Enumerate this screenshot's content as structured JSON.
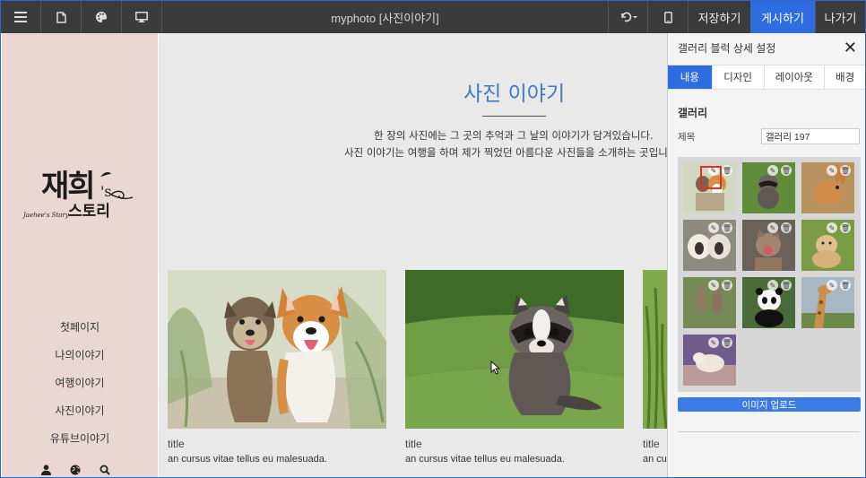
{
  "topbar": {
    "title": "myphoto [사진이야기]",
    "left_icons": [
      "menu-icon",
      "page-icon",
      "palette-icon",
      "monitor-icon"
    ],
    "undo_icon": "undo-icon",
    "mobile_icon": "mobile-icon",
    "save_label": "저장하기",
    "publish_label": "게시하기",
    "exit_label": "나가기",
    "accent_color": "#2d6de0"
  },
  "sidebar": {
    "logo": {
      "main_text": "재희",
      "suffix": "'s",
      "sub_text": "스토리",
      "script_text": "Jaehee's Story"
    },
    "nav_items": [
      "첫페이지",
      "나의이야기",
      "여행이야기",
      "사진이야기",
      "유튜브이야기"
    ],
    "bottom_icons": [
      "user-icon",
      "globe-icon",
      "search-icon"
    ],
    "background": "#ead7d4"
  },
  "main": {
    "title": "사진 이야기",
    "description_line1": "한 장의 사진에는 그 곳의 추억과 그 날의 이야기가 담겨있습니다.",
    "description_line2": "사진 이야기는 여행을 하며 제가 찍었던 아름다운 사진들을 소개하는 곳입니",
    "title_color": "#3e7bc4",
    "cards": [
      {
        "image": "dogs-photo",
        "title": "title",
        "text": "an cursus vitae tellus eu malesuada."
      },
      {
        "image": "raccoon-photo",
        "title": "title",
        "text": "an cursus vitae tellus eu malesuada."
      },
      {
        "image": "grass-photo",
        "title": "title",
        "text": "an cursus vitae tellus eu malesuada."
      }
    ]
  },
  "panel": {
    "header": "갤러리 블럭 상세 설정",
    "close_icon": "close-icon",
    "tabs": [
      {
        "label": "내용",
        "active": true
      },
      {
        "label": "디자인",
        "active": false
      },
      {
        "label": "레이아웃",
        "active": false
      },
      {
        "label": "배경",
        "active": false
      }
    ],
    "section_label": "갤러리",
    "title_label": "제목",
    "title_value": "갤러리 197",
    "thumbnails": [
      "dogs-thumb",
      "raccoon-thumb",
      "rabbit-thumb",
      "sheep-thumb",
      "cat-thumb",
      "puppy-thumb",
      "kangaroo-thumb",
      "panda-thumb",
      "giraffe-thumb",
      "fox-thumb"
    ],
    "edit_icon": "pencil-icon",
    "delete_icon": "trash-icon",
    "upload_label": "이미지 업로드"
  }
}
